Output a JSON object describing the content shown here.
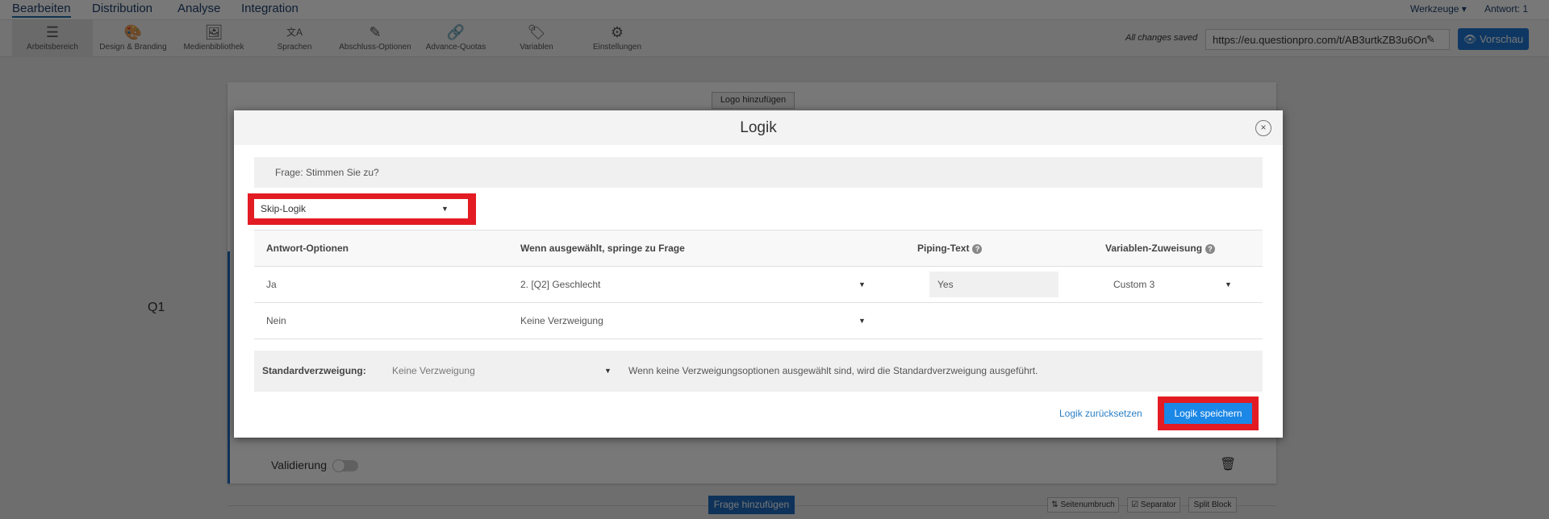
{
  "nav": {
    "tabs": [
      "Bearbeiten",
      "Distribution",
      "Analyse",
      "Integration"
    ],
    "tools_menu": "Werkzeuge ▾",
    "responses": "Antwort: 1"
  },
  "toolbar": {
    "items": [
      {
        "label": "Arbeitsbereich",
        "icon": "☰"
      },
      {
        "label": "Design & Branding",
        "icon": "🎨"
      },
      {
        "label": "Medienbibliothek",
        "icon": "🖼"
      },
      {
        "label": "Sprachen",
        "icon": "文A"
      },
      {
        "label": "Abschluss-Optionen",
        "icon": "✎"
      },
      {
        "label": "Advance-Quotas",
        "icon": "🔗"
      },
      {
        "label": "Variablen",
        "icon": "🏷"
      },
      {
        "label": "Einstellungen",
        "icon": "⚙"
      }
    ],
    "save_status": "All changes saved",
    "url": "https://eu.questionpro.com/t/AB3urtkZB3u6On",
    "edit_icon": "✎",
    "preview": "👁 Vorschau"
  },
  "survey": {
    "add_logo": "Logo hinzufügen",
    "question_number": "Q1",
    "validation": "Validierung",
    "add_question": "Frage hinzufügen",
    "page_break": "⇅ Seitenumbruch",
    "separator": "☑ Separator",
    "split_block": "Split Block",
    "trash_icon": "🗑"
  },
  "modal": {
    "title": "Logik",
    "close": "×",
    "question": "Frage: Stimmen Sie zu?",
    "logic_type": "Skip-Logik",
    "headers": {
      "answer": "Antwort-Optionen",
      "jump": "Wenn ausgewählt, springe zu Frage",
      "piping": "Piping-Text",
      "variable": "Variablen-Zuweisung",
      "help": "?"
    },
    "rows": [
      {
        "answer": "Ja",
        "jump": "2. [Q2] Geschlecht",
        "piping": "Yes",
        "variable": "Custom 3"
      },
      {
        "answer": "Nein",
        "jump": "Keine Verzweigung"
      }
    ],
    "default_label": "Standardverzweigung:",
    "default_value": "Keine Verzweigung",
    "default_note": "Wenn keine Verzweigungsoptionen ausgewählt sind, wird die Standardverzweigung ausgeführt.",
    "reset": "Logik zurücksetzen",
    "save": "Logik speichern",
    "arrow": "▼"
  },
  "colors": {
    "highlight": "#e31b23",
    "primary": "#1b87e6"
  }
}
